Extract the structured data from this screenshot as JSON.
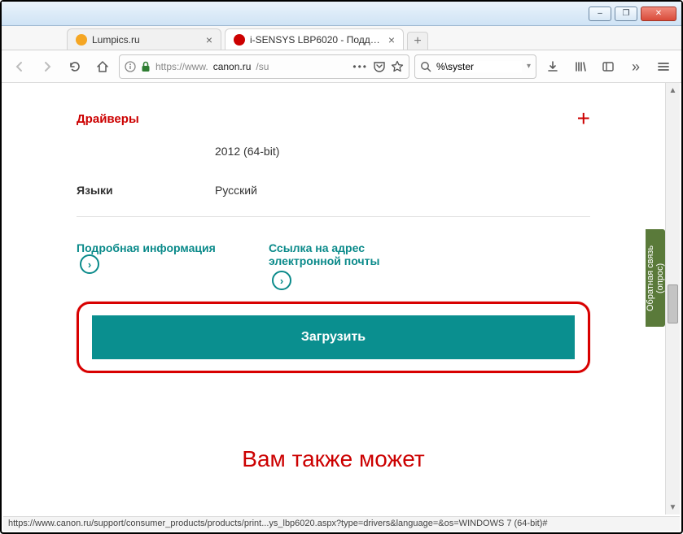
{
  "window": {
    "minimize": "–",
    "maximize": "❐",
    "close": "✕"
  },
  "tabs": [
    {
      "label": "Lumpics.ru",
      "favicon": "#f5a623",
      "active": false
    },
    {
      "label": "i-SENSYS LBP6020 - Поддержка",
      "favicon": "#cc0000",
      "active": true
    }
  ],
  "toolbar": {
    "url": "https://www.canon.ru/su",
    "url_host_prefix": "https://www.",
    "url_host": "canon.ru",
    "url_path": "/su",
    "search_value": "%\\syster"
  },
  "page": {
    "section_title": "Драйверы",
    "os_value": "2012 (64-bit)",
    "lang_label": "Языки",
    "lang_value": "Русский",
    "more_info": "Подробная информация",
    "email_link": "Ссылка на адрес электронной почты",
    "download": "Загрузить",
    "bottom_heading": "Вам также может",
    "feedback": "Обратная связь\n(опрос)"
  },
  "status": "https://www.canon.ru/support/consumer_products/products/print...ys_lbp6020.aspx?type=drivers&language=&os=WINDOWS 7 (64-bit)#"
}
